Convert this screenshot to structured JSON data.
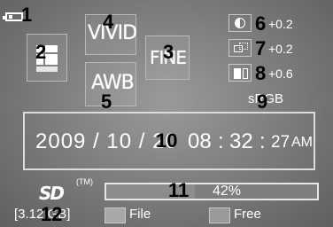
{
  "callouts": {
    "n1": "1",
    "n2": "2",
    "n3": "3",
    "n4": "4",
    "n5": "5",
    "n6": "6",
    "n7": "7",
    "n8": "8",
    "n9": "9",
    "n10": "10",
    "n11": "11",
    "n12": "12"
  },
  "icons": {
    "battery": "battery-icon",
    "image_size": "image-size-icon",
    "contrast": "contrast-icon",
    "sharpness": "sharpness-icon",
    "saturation": "saturation-icon",
    "sd_logo": "sd-card-icon"
  },
  "picture_style": "VIVID",
  "white_balance": "AWB",
  "quality": "FINE",
  "adjustments": {
    "contrast": "+0.2",
    "sharpness": "+0.2",
    "saturation": "+0.6"
  },
  "color_space": "sRGB",
  "datetime": {
    "date": "2009 / 10 / 20",
    "hour": "08",
    "minute": "32",
    "second": "27",
    "ampm": "AM",
    "sep": ":"
  },
  "storage": {
    "tm": "(TM)",
    "usage_percent": 42,
    "usage_label": "42%",
    "capacity": "[3.12 GB]",
    "legend_file": "File",
    "legend_free": "Free"
  },
  "colors": {
    "background": "#7a7a7a",
    "text": "#ffffff",
    "callout": "#000000"
  }
}
